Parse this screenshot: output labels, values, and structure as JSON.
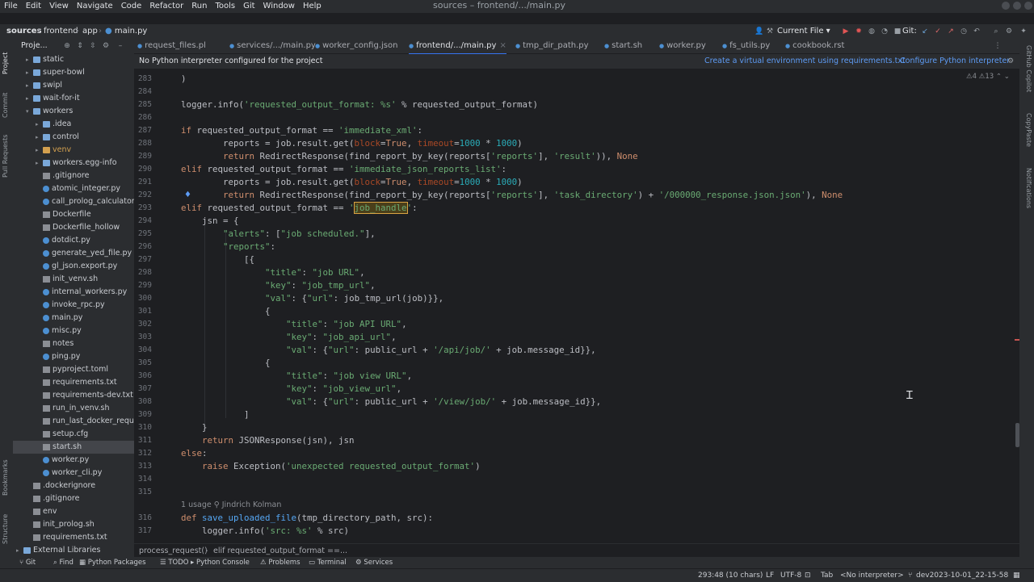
{
  "window_title": "sources – frontend/.../main.py",
  "menu": [
    "File",
    "Edit",
    "View",
    "Navigate",
    "Code",
    "Refactor",
    "Run",
    "Tools",
    "Git",
    "Window",
    "Help"
  ],
  "breadcrumb": [
    "sources",
    "frontend",
    "app",
    "main.py"
  ],
  "run_config": "Current File",
  "git_label": "Git:",
  "tabs": [
    {
      "label": "request_files.pl",
      "active": false
    },
    {
      "label": "services/.../main.py",
      "active": false
    },
    {
      "label": "worker_config.json",
      "active": false
    },
    {
      "label": "frontend/.../main.py",
      "active": true
    },
    {
      "label": "tmp_dir_path.py",
      "active": false
    },
    {
      "label": "start.sh",
      "active": false
    },
    {
      "label": "worker.py",
      "active": false
    },
    {
      "label": "fs_utils.py",
      "active": false
    },
    {
      "label": "cookbook.rst",
      "active": false
    }
  ],
  "project_panel_title": "Proje...",
  "tree": [
    {
      "label": "static",
      "indent": 1,
      "kind": "folder",
      "arrow": "▸"
    },
    {
      "label": "super-bowl",
      "indent": 1,
      "kind": "folder",
      "arrow": "▸"
    },
    {
      "label": "swipl",
      "indent": 1,
      "kind": "folder",
      "arrow": "▸"
    },
    {
      "label": "wait-for-it",
      "indent": 1,
      "kind": "folder",
      "arrow": "▸"
    },
    {
      "label": "workers",
      "indent": 1,
      "kind": "folder",
      "arrow": "▾"
    },
    {
      "label": ".idea",
      "indent": 2,
      "kind": "folder",
      "arrow": "▸"
    },
    {
      "label": "control",
      "indent": 2,
      "kind": "folder",
      "arrow": "▸"
    },
    {
      "label": "venv",
      "indent": 2,
      "kind": "folder-excl",
      "arrow": "▸"
    },
    {
      "label": "workers.egg-info",
      "indent": 2,
      "kind": "folder",
      "arrow": "▸"
    },
    {
      "label": ".gitignore",
      "indent": 2,
      "kind": "file"
    },
    {
      "label": "atomic_integer.py",
      "indent": 2,
      "kind": "py"
    },
    {
      "label": "call_prolog_calculator",
      "indent": 2,
      "kind": "py"
    },
    {
      "label": "Dockerfile",
      "indent": 2,
      "kind": "file"
    },
    {
      "label": "Dockerfile_hollow",
      "indent": 2,
      "kind": "file"
    },
    {
      "label": "dotdict.py",
      "indent": 2,
      "kind": "py"
    },
    {
      "label": "generate_yed_file.py",
      "indent": 2,
      "kind": "py"
    },
    {
      "label": "gl_json.export.py",
      "indent": 2,
      "kind": "py"
    },
    {
      "label": "init_venv.sh",
      "indent": 2,
      "kind": "file"
    },
    {
      "label": "internal_workers.py",
      "indent": 2,
      "kind": "py"
    },
    {
      "label": "invoke_rpc.py",
      "indent": 2,
      "kind": "py"
    },
    {
      "label": "main.py",
      "indent": 2,
      "kind": "py"
    },
    {
      "label": "misc.py",
      "indent": 2,
      "kind": "py"
    },
    {
      "label": "notes",
      "indent": 2,
      "kind": "file"
    },
    {
      "label": "ping.py",
      "indent": 2,
      "kind": "py"
    },
    {
      "label": "pyproject.toml",
      "indent": 2,
      "kind": "file"
    },
    {
      "label": "requirements.txt",
      "indent": 2,
      "kind": "file"
    },
    {
      "label": "requirements-dev.txt",
      "indent": 2,
      "kind": "file"
    },
    {
      "label": "run_in_venv.sh",
      "indent": 2,
      "kind": "file"
    },
    {
      "label": "run_last_docker_reque",
      "indent": 2,
      "kind": "file"
    },
    {
      "label": "setup.cfg",
      "indent": 2,
      "kind": "file"
    },
    {
      "label": "start.sh",
      "indent": 2,
      "kind": "file",
      "selected": true
    },
    {
      "label": "worker.py",
      "indent": 2,
      "kind": "py"
    },
    {
      "label": "worker_cli.py",
      "indent": 2,
      "kind": "py"
    },
    {
      "label": ".dockerignore",
      "indent": 1,
      "kind": "file"
    },
    {
      "label": ".gitignore",
      "indent": 1,
      "kind": "file"
    },
    {
      "label": "env",
      "indent": 1,
      "kind": "file"
    },
    {
      "label": "init_prolog.sh",
      "indent": 1,
      "kind": "file"
    },
    {
      "label": "requirements.txt",
      "indent": 1,
      "kind": "file"
    },
    {
      "label": "External Libraries",
      "indent": 0,
      "kind": "folder",
      "arrow": "▸"
    }
  ],
  "notice": {
    "text": "No Python interpreter configured for the project",
    "link1": "Create a virtual environment using requirements.txt",
    "link2": "Configure Python interpreter"
  },
  "inspection_counts": {
    "warnings": "4",
    "weak": "13"
  },
  "code_lines": [
    {
      "n": "283",
      "h": "<span>)</span>"
    },
    {
      "n": "284",
      "h": ""
    },
    {
      "n": "285",
      "h": "logger.info(<span class='str'>'requested_output_format: %s'</span> % requested_output_format)"
    },
    {
      "n": "286",
      "h": ""
    },
    {
      "n": "287",
      "h": "<span class='kw'>if</span> requested_output_format == <span class='str'>'immediate_xml'</span>:"
    },
    {
      "n": "288",
      "h": "        reports = job.result.get(<span class='prm'>block</span>=<span class='kw'>True</span>, <span class='prm'>timeout</span>=<span class='num'>1000</span> * <span class='num'>1000</span>)"
    },
    {
      "n": "289",
      "h": "        <span class='kw'>return</span> RedirectResponse(find_report_by_key(reports[<span class='str'>'reports'</span>], <span class='str'>'result'</span>)), <span class='kw'>None</span>"
    },
    {
      "n": "290",
      "h": "<span class='kw'>elif</span> requested_output_format == <span class='str'>'immediate_json_reports_list'</span>:"
    },
    {
      "n": "291",
      "h": "        reports = job.result.get(<span class='prm'>block</span>=<span class='kw'>True</span>, <span class='prm'>timeout</span>=<span class='num'>1000</span> * <span class='num'>1000</span>)"
    },
    {
      "n": "292",
      "h": "        <span class='kw'>return</span> RedirectResponse(find_report_by_key(reports[<span class='str'>'reports'</span>], <span class='str'>'task_directory'</span>) + <span class='str'>'/000000_response.json.json'</span>), <span class='kw'>None</span>"
    },
    {
      "n": "293",
      "h": "<span class='kw'>elif</span> requested_output_format == <span class='str'>'</span><span class='hl'>job_handle</span><span class='str'>'</span>:"
    },
    {
      "n": "294",
      "h": "    jsn = {"
    },
    {
      "n": "295",
      "h": "        <span class='str'>\"alerts\"</span>: [<span class='str'>\"job scheduled.\"</span>],"
    },
    {
      "n": "296",
      "h": "        <span class='str'>\"reports\"</span>:"
    },
    {
      "n": "297",
      "h": "            [{"
    },
    {
      "n": "298",
      "h": "                <span class='str'>\"title\"</span>: <span class='str'>\"job URL\"</span>,"
    },
    {
      "n": "299",
      "h": "                <span class='str'>\"key\"</span>: <span class='str'>\"job_tmp_url\"</span>,"
    },
    {
      "n": "300",
      "h": "                <span class='str'>\"val\"</span>: {<span class='str'>\"url\"</span>: job_tmp_url(job)}},"
    },
    {
      "n": "301",
      "h": "                {"
    },
    {
      "n": "302",
      "h": "                    <span class='str'>\"title\"</span>: <span class='str'>\"job API URL\"</span>,"
    },
    {
      "n": "303",
      "h": "                    <span class='str'>\"key\"</span>: <span class='str'>\"job_api_url\"</span>,"
    },
    {
      "n": "304",
      "h": "                    <span class='str'>\"val\"</span>: {<span class='str'>\"url\"</span>: public_url + <span class='str'>'/api/job/'</span> + job.message_id}},"
    },
    {
      "n": "305",
      "h": "                {"
    },
    {
      "n": "306",
      "h": "                    <span class='str'>\"title\"</span>: <span class='str'>\"job view URL\"</span>,"
    },
    {
      "n": "307",
      "h": "                    <span class='str'>\"key\"</span>: <span class='str'>\"job_view_url\"</span>,"
    },
    {
      "n": "308",
      "h": "                    <span class='str'>\"val\"</span>: {<span class='str'>\"url\"</span>: public_url + <span class='str'>'/view/job/'</span> + job.message_id}},"
    },
    {
      "n": "309",
      "h": "            ]"
    },
    {
      "n": "310",
      "h": "    }"
    },
    {
      "n": "311",
      "h": "    <span class='kw'>return</span> JSONResponse(jsn), jsn"
    },
    {
      "n": "312",
      "h": "<span class='kw'>else</span>:"
    },
    {
      "n": "313",
      "h": "    <span class='kw'>raise</span> Exception(<span class='str'>'unexpected requested_output_format'</span>)"
    },
    {
      "n": "314",
      "h": ""
    },
    {
      "n": "315",
      "h": ""
    },
    {
      "n": "",
      "h": "",
      "hint": "1 usage   ⚲ Jindrich Kolman"
    },
    {
      "n": "316",
      "h": "<span class='kw'>def</span> <span class='fn'>save_uploaded_file</span>(tmp_directory_path, src):"
    },
    {
      "n": "317",
      "h": "    logger.info(<span class='str'>'src: %s'</span> % src)"
    }
  ],
  "editor_breadcrumb": [
    "process_request()",
    "elif requested_output_format ==..."
  ],
  "tool_windows": [
    {
      "label": "Git",
      "icon": "⑂"
    },
    {
      "label": "Find",
      "icon": "⌕"
    },
    {
      "label": "Python Packages",
      "icon": "▦"
    },
    {
      "label": "TODO",
      "icon": "☰"
    },
    {
      "label": "Python Console",
      "icon": "▸"
    },
    {
      "label": "Problems",
      "icon": "⚠"
    },
    {
      "label": "Terminal",
      "icon": "▭"
    },
    {
      "label": "Services",
      "icon": "⚙"
    }
  ],
  "left_strip_labels": [
    "Project",
    "Commit",
    "Pull Requests",
    "Bookmarks",
    "Structure"
  ],
  "right_strip_labels": [
    "GitHub Copilot",
    "CopyPaste",
    "Notifications"
  ],
  "status": {
    "position": "293:48 (10 chars)",
    "line_sep": "LF",
    "encoding": "UTF-8",
    "indent": "Tab",
    "interpreter": "<No interpreter>",
    "branch": "dev2023-10-01_22-15-58"
  },
  "colors": {
    "accent": "#3574f0",
    "keyword": "#cf8e6d",
    "string": "#6aab73",
    "number": "#2aacb8",
    "highlight": "#d9a343"
  }
}
